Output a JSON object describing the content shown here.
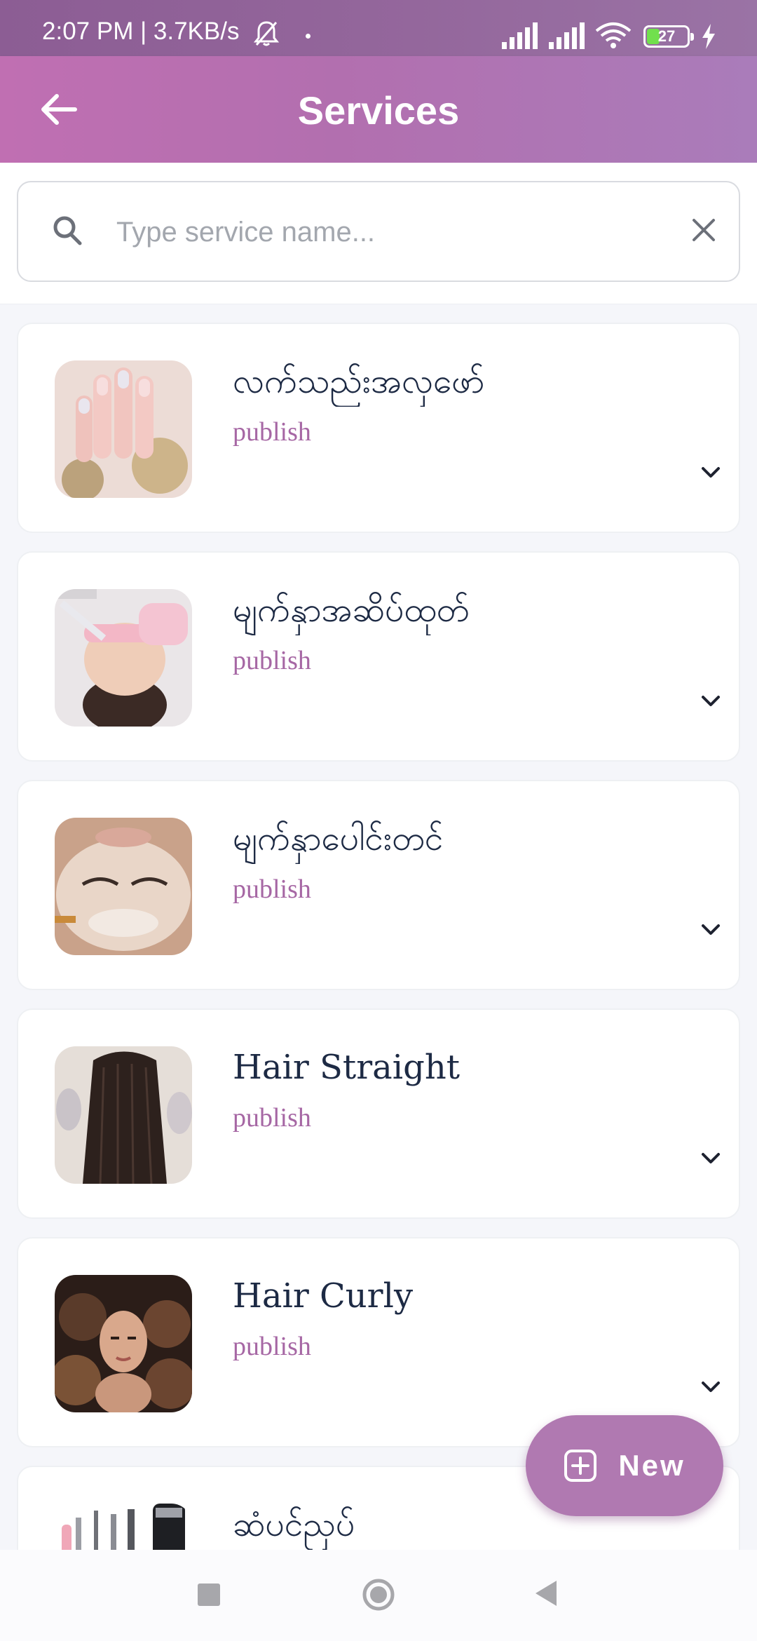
{
  "status_bar": {
    "time": "2:07 PM | 3.7KB/s",
    "battery": "27"
  },
  "header": {
    "title": "Services"
  },
  "search": {
    "placeholder": "Type service name...",
    "value": ""
  },
  "services": [
    {
      "name": "လက်သည်းအလှဖော်",
      "status": "publish",
      "image": "nails-photo"
    },
    {
      "name": "မျက်နှာအဆိပ်ထုတ်",
      "status": "publish",
      "image": "facial-treatment-photo"
    },
    {
      "name": "မျက်နှာပေါင်းတင်",
      "status": "publish",
      "image": "face-mask-photo"
    },
    {
      "name": "Hair Straight",
      "status": "publish",
      "image": "straight-hair-photo"
    },
    {
      "name": "Hair Curly",
      "status": "publish",
      "image": "curly-hair-photo"
    },
    {
      "name": "ဆံပင်ညှပ်",
      "status": "",
      "image": "haircut-tools-photo"
    }
  ],
  "fab": {
    "label": "New"
  },
  "colors": {
    "accent": "#b079b1",
    "status_text": "#a667a4",
    "title_text": "#1d2a44"
  }
}
